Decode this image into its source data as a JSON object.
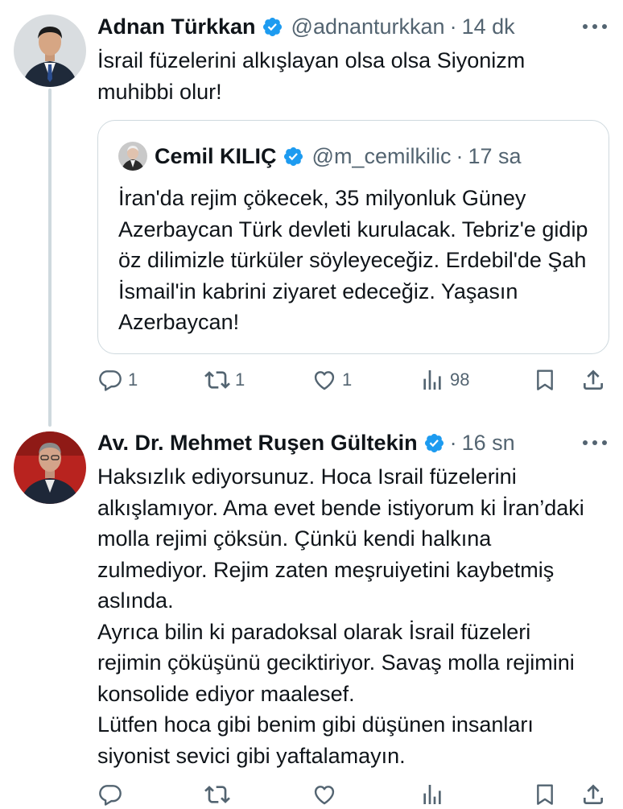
{
  "tweet1": {
    "name": "Adnan Türkkan",
    "handle": "@adnanturkkan",
    "dot": "·",
    "time": "14 dk",
    "text": "İsrail füzelerini alkışlayan olsa olsa Siyonizm muhibbi olur!",
    "quote": {
      "name": "Cemil KILIÇ",
      "handle": "@m_cemilkilic",
      "dot": "·",
      "time": "17 sa",
      "text": "İran'da rejim çökecek, 35 milyonluk  Güney Azerbaycan Türk devleti kurulacak. Tebriz'e gidip öz dilimizle türküler söyleyeceğiz. Erdebil'de Şah İsmail'in kabrini ziyaret edeceğiz. Yaşasın Azerbaycan!"
    },
    "actions": {
      "reply_count": "1",
      "retweet_count": "1",
      "like_count": "1",
      "view_count": "98"
    }
  },
  "tweet2": {
    "name": "Av. Dr. Mehmet Ruşen Gültekin",
    "dot": "·",
    "time": "16 sn",
    "text_lines": [
      "Haksızlık ediyorsunuz. Hoca Israil füzelerini alkışlamıyor. Ama evet bende istiyorum ki İran’daki molla rejimi çöksün. Çünkü kendi halkına zulmediyor. Rejim zaten meşruiyetini kaybetmiş aslında.",
      "Ayrıca bilin ki paradoksal olarak İsrail füzeleri rejimin çöküşünü geciktiriyor. Savaş molla rejimini konsolide ediyor maalesef.",
      "Lütfen hoca gibi benim gibi düşünen insanları siyonist sevici gibi yaftalamayın."
    ]
  },
  "colors": {
    "verified": "#1d9bf0",
    "secondary_text": "#536471",
    "border": "#cfd9de",
    "text": "#0f1419"
  },
  "icons": [
    "more-icon",
    "verified-badge-icon",
    "reply-icon",
    "retweet-icon",
    "like-icon",
    "views-icon",
    "bookmark-icon",
    "share-icon"
  ]
}
